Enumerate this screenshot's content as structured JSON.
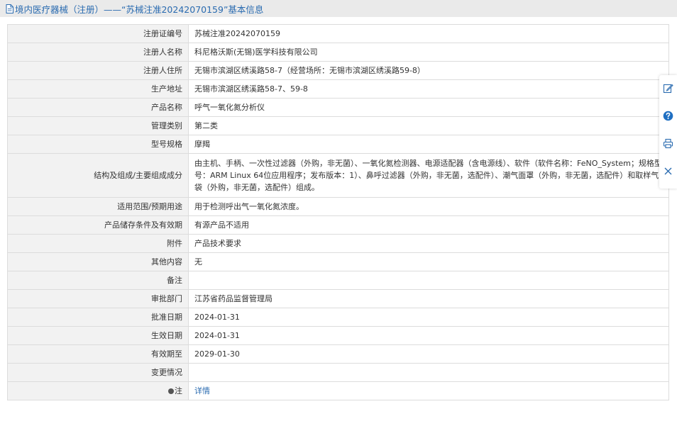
{
  "header": {
    "title": "境内医疗器械（注册）——“苏械注准20242070159”基本信息",
    "icon": "document-icon"
  },
  "rows": [
    {
      "label": "注册证编号",
      "value": "苏械注准20242070159"
    },
    {
      "label": "注册人名称",
      "value": "科尼格沃斯(无锡)医学科技有限公司"
    },
    {
      "label": "注册人住所",
      "value": "无锡市滨湖区绣溪路58-7（经营场所：无锡市滨湖区绣溪路59-8）"
    },
    {
      "label": "生产地址",
      "value": "无锡市滨湖区绣溪路58-7、59-8"
    },
    {
      "label": "产品名称",
      "value": "呼气一氧化氮分析仪"
    },
    {
      "label": "管理类别",
      "value": "第二类"
    },
    {
      "label": "型号规格",
      "value": "摩羯"
    },
    {
      "label": "结构及组成/主要组成成分",
      "value": "由主机、手柄、一次性过滤器（外购，非无菌）、一氧化氮检测器、电源适配器（含电源线）、软件（软件名称：FeNO_System；规格型号：ARM Linux 64位应用程序；发布版本：1）、鼻呼过滤器（外购，非无菌，选配件）、潮气面罩（外购，非无菌，选配件）和取样气袋（外购，非无菌，选配件）组成。"
    },
    {
      "label": "适用范围/预期用途",
      "value": "用于检测呼出气一氧化氮浓度。"
    },
    {
      "label": "产品储存条件及有效期",
      "value": "有源产品不适用"
    },
    {
      "label": "附件",
      "value": "产品技术要求"
    },
    {
      "label": "其他内容",
      "value": "无"
    },
    {
      "label": "备注",
      "value": ""
    },
    {
      "label": "审批部门",
      "value": "江苏省药品监督管理局"
    },
    {
      "label": "批准日期",
      "value": "2024-01-31"
    },
    {
      "label": "生效日期",
      "value": "2024-01-31"
    },
    {
      "label": "有效期至",
      "value": "2029-01-30"
    },
    {
      "label": "变更情况",
      "value": ""
    }
  ],
  "note_row": {
    "label": "注",
    "link_text": "详情",
    "icon": "pin-icon"
  },
  "sidetools": [
    "edit-icon",
    "help-icon",
    "print-icon",
    "close-icon"
  ],
  "colors": {
    "accent": "#2a6bb0",
    "label_bg": "#f2f2f2",
    "border": "#dcdcdc",
    "header_bg": "#eaeaea",
    "help_fill": "#1f6fc2"
  }
}
